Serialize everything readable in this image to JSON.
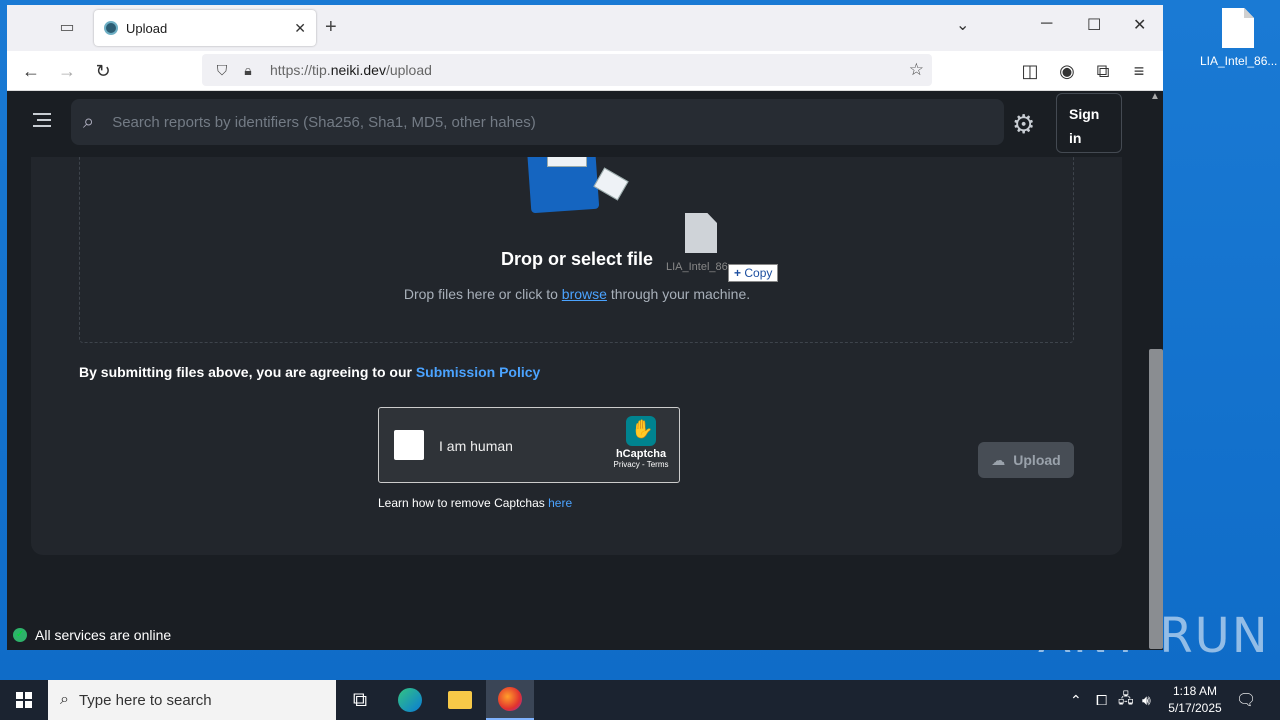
{
  "desktop": {
    "icon_label": "LIA_Intel_86...",
    "watermark": "ANY  RUN"
  },
  "browser": {
    "tab_title": "Upload",
    "url_prefix": "https://tip.",
    "url_domain": "neiki.dev",
    "url_path": "/upload"
  },
  "site": {
    "search_placeholder": "Search reports by identifiers (Sha256, Sha1, MD5, other hahes)",
    "signin_label": "Sign in",
    "drop_title": "Drop or select file",
    "drop_sub_before": "Drop files here or click to ",
    "drop_sub_link": "browse",
    "drop_sub_after": " through your machine.",
    "drag_file_label": "LIA_Intel_86",
    "copy_badge": "Copy",
    "policy_text": "By submitting files above, you are agreeing to our ",
    "policy_link": "Submission Policy",
    "captcha_label": "I am human",
    "captcha_brand": "hCaptcha",
    "captcha_terms": "Privacy - Terms",
    "remove_text": "Learn how to remove Captchas ",
    "remove_link": "here",
    "upload_label": "Upload",
    "status_text": "All services are online"
  },
  "taskbar": {
    "search_placeholder": "Type here to search",
    "time": "1:18 AM",
    "date": "5/17/2025"
  },
  "colors": {
    "accent_link": "#4ba3ff",
    "page_bg": "#1a1e23",
    "status_ok": "#2db36a"
  }
}
